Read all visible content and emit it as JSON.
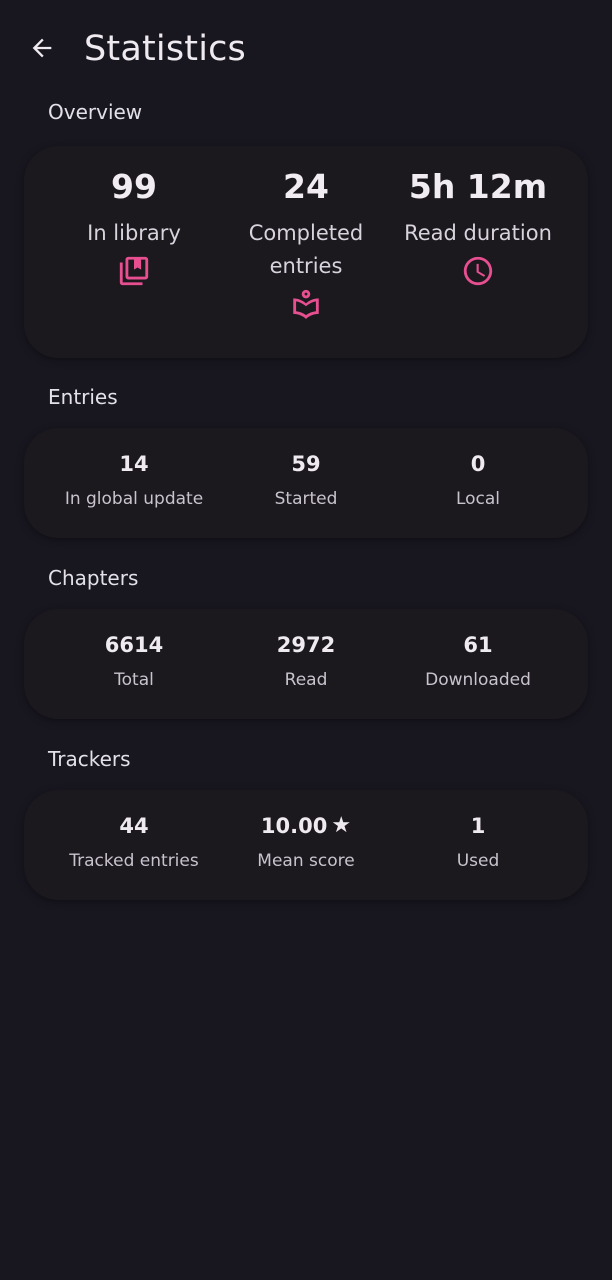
{
  "header": {
    "title": "Statistics",
    "back_icon": "arrow-back-icon"
  },
  "colors": {
    "background": "#18161f",
    "card": "#1b181e",
    "accent": "#e84f91",
    "text": "#eeeaf0"
  },
  "overview": {
    "label": "Overview",
    "items": [
      {
        "value": "99",
        "label": "In library",
        "icon": "library-books-icon"
      },
      {
        "value": "24",
        "label": "Completed entries",
        "icon": "menu-book-icon"
      },
      {
        "value": "5h 12m",
        "label": "Read duration",
        "icon": "clock-icon"
      }
    ]
  },
  "entries": {
    "label": "Entries",
    "items": [
      {
        "value": "14",
        "label": "In global update"
      },
      {
        "value": "59",
        "label": "Started"
      },
      {
        "value": "0",
        "label": "Local"
      }
    ]
  },
  "chapters": {
    "label": "Chapters",
    "items": [
      {
        "value": "6614",
        "label": "Total"
      },
      {
        "value": "2972",
        "label": "Read"
      },
      {
        "value": "61",
        "label": "Downloaded"
      }
    ]
  },
  "trackers": {
    "label": "Trackers",
    "items": [
      {
        "value": "44",
        "label": "Tracked entries"
      },
      {
        "value": "10.00",
        "label": "Mean score",
        "icon": "star-icon",
        "icon_glyph": "★"
      },
      {
        "value": "1",
        "label": "Used"
      }
    ]
  }
}
